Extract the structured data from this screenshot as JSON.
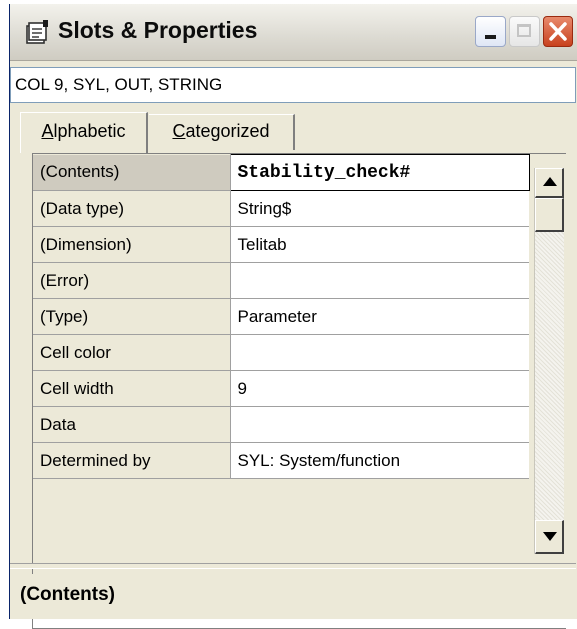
{
  "window": {
    "title": "Slots & Properties",
    "icon": "properties-sheet-icon",
    "buttons": {
      "minimize": "minimize-button",
      "maximize": "maximize-button",
      "close": "close-button"
    }
  },
  "object_selector": {
    "value": "COL 9, SYL, OUT, STRING"
  },
  "tabs": [
    {
      "label": "Alphabetic",
      "active": true
    },
    {
      "label": "Categorized",
      "active": false
    }
  ],
  "properties": [
    {
      "name": "(Contents)",
      "value": "Stability_check#",
      "selected": true
    },
    {
      "name": "(Data type)",
      "value": "String$"
    },
    {
      "name": "(Dimension)",
      "value": "Telitab"
    },
    {
      "name": "(Error)",
      "value": ""
    },
    {
      "name": "(Type)",
      "value": "Parameter"
    },
    {
      "name": "Cell color",
      "value": ""
    },
    {
      "name": "Cell width",
      "value": "9"
    },
    {
      "name": "Data",
      "value": ""
    },
    {
      "name": "Determined by",
      "value": "SYL: System/function"
    }
  ],
  "description": {
    "title": "(Contents)"
  },
  "colors": {
    "chrome": "#ece9d8",
    "close_button": "#c8411e",
    "grid_line": "#a0a0a0"
  }
}
